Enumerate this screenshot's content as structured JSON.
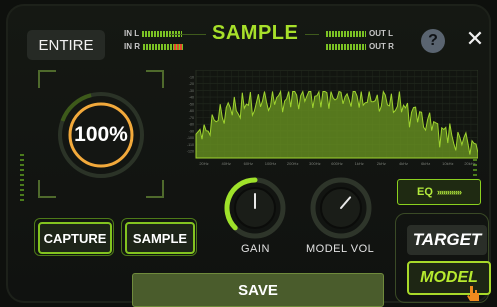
{
  "header": {
    "entire_label": "ENTIRE",
    "title": "SAMPLE",
    "input_meters": [
      {
        "label": "IN L"
      },
      {
        "label": "IN R"
      }
    ],
    "output_meters": [
      {
        "label": "OUT L"
      },
      {
        "label": "OUT R"
      }
    ],
    "help_label": "?",
    "close_label": "✕"
  },
  "percent_dial": {
    "value_text": "100%",
    "fill_fraction": 1.0,
    "color": "#f2a93b"
  },
  "spectrum": {
    "y_ticks": [
      "-10",
      "-20",
      "-30",
      "-40",
      "-50",
      "-60",
      "-70",
      "-80",
      "-90",
      "-100",
      "-110",
      "-120"
    ],
    "x_ticks": [
      "20Hz",
      "40Hz",
      "60Hz",
      "100Hz",
      "200Hz",
      "300Hz",
      "600Hz",
      "1kHz",
      "2kHz",
      "4kHz",
      "6kHz",
      "10kHz",
      "20kHz"
    ],
    "color": "#8bd11f"
  },
  "eq_button": {
    "label": "EQ",
    "chevrons": "»»»»»»"
  },
  "capture_button": {
    "label": "CAPTURE"
  },
  "sample_button": {
    "label": "SAMPLE"
  },
  "gain_knob": {
    "label": "GAIN",
    "level": 0.5,
    "color": "#9fe22a"
  },
  "model_vol_knob": {
    "label": "MODEL VOL",
    "level": 0.65
  },
  "save_button": {
    "label": "SAVE"
  },
  "mode_buttons": {
    "target_label": "TARGET",
    "model_label": "MODEL"
  },
  "colors": {
    "accent": "#a7e02a",
    "panel_bg": "#101210"
  }
}
